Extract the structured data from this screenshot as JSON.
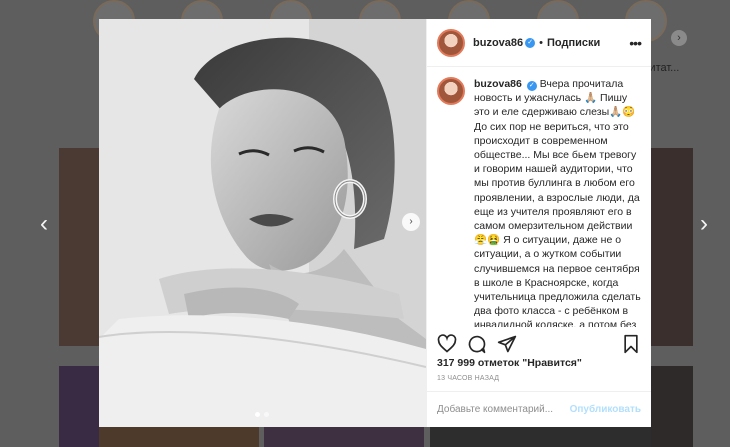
{
  "header": {
    "username": "buzova86",
    "separator": "•",
    "follow_label": "Подписки",
    "more_icon": "ellipsis-icon"
  },
  "caption": {
    "username": "buzova86",
    "text": "Вчера прочитала новость и ужаснулась 🙏🏼 Пишу это и еле сдерживаю слезы🙏🏼😳 До сих пор не вериться, что это происходит в современном обществе... Мы все бьем тревогу и говорим нашей аудитории, что мы против буллинга в любом его проявлении, а взрослые люди, да еще из учителя проявляют его в самом омерзительном действии 😤🤮 Я о ситуации, даже не о ситуации, а о жутком событии случившемся на первое сентября в школе в Красноярске, когда учительница предложила сделать два фото класса - с ребёнком в инвалидной коляске, а потом без него... Это зачем? Почему родители которые присутствовали во время"
  },
  "actions": {
    "icons": [
      "heart-icon",
      "comment-icon",
      "share-icon",
      "bookmark-icon"
    ]
  },
  "likes": "317 999 отметок \"Нравится\"",
  "time_ago": "13 ЧАСОВ НАЗАД",
  "comment_box": {
    "placeholder": "Добавьте комментарий...",
    "publish_label": "Опубликовать"
  },
  "background": {
    "story_caption": "дитат..."
  },
  "photo": {
    "slides_total": 2,
    "active_slide": 1
  },
  "colors": {
    "verified_badge": "#3897f0",
    "publish_disabled": "#b2dffc",
    "overlay": "#5e5e5e"
  }
}
